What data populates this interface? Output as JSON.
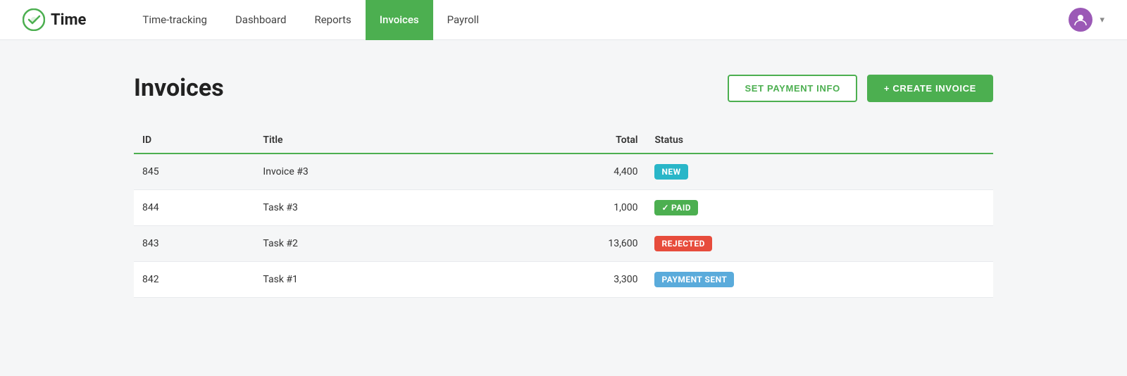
{
  "brand": {
    "name": "Time"
  },
  "nav": {
    "links": [
      {
        "id": "time-tracking",
        "label": "Time-tracking",
        "active": false
      },
      {
        "id": "dashboard",
        "label": "Dashboard",
        "active": false
      },
      {
        "id": "reports",
        "label": "Reports",
        "active": false
      },
      {
        "id": "invoices",
        "label": "Invoices",
        "active": true
      },
      {
        "id": "payroll",
        "label": "Payroll",
        "active": false
      }
    ]
  },
  "page": {
    "title": "Invoices",
    "set_payment_info_label": "SET PAYMENT INFO",
    "create_invoice_label": "+ CREATE INVOICE"
  },
  "table": {
    "columns": [
      "ID",
      "Title",
      "Total",
      "Status"
    ],
    "rows": [
      {
        "id": "845",
        "title": "Invoice #3",
        "total": "4,400",
        "status": "NEW",
        "status_type": "new"
      },
      {
        "id": "844",
        "title": "Task #3",
        "total": "1,000",
        "status": "PAID",
        "status_type": "paid"
      },
      {
        "id": "843",
        "title": "Task #2",
        "total": "13,600",
        "status": "REJECTED",
        "status_type": "rejected"
      },
      {
        "id": "842",
        "title": "Task #1",
        "total": "3,300",
        "status": "PAYMENT SENT",
        "status_type": "payment-sent"
      }
    ]
  },
  "colors": {
    "brand_green": "#4caf50",
    "badge_new": "#29b6c8",
    "badge_paid": "#4caf50",
    "badge_rejected": "#e74c3c",
    "badge_payment_sent": "#5aabdb"
  }
}
